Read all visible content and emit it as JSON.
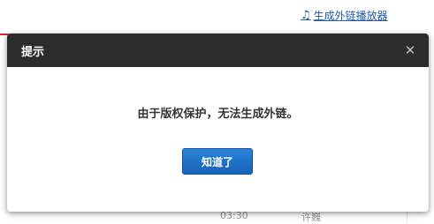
{
  "background": {
    "link_icon": "music-note-icon",
    "link_text": "生成外链播放器",
    "row_time": "03:30",
    "row_author": "许巍"
  },
  "dialog": {
    "title": "提示",
    "close_icon": "close-icon",
    "message": "由于版权保护，无法生成外链。",
    "ok_label": "知道了"
  },
  "colors": {
    "header_bg": "#2c2c2c",
    "button_blue": "#1d6fc4",
    "link_blue": "#1f5aa8",
    "brand_red": "#c62f2f"
  }
}
